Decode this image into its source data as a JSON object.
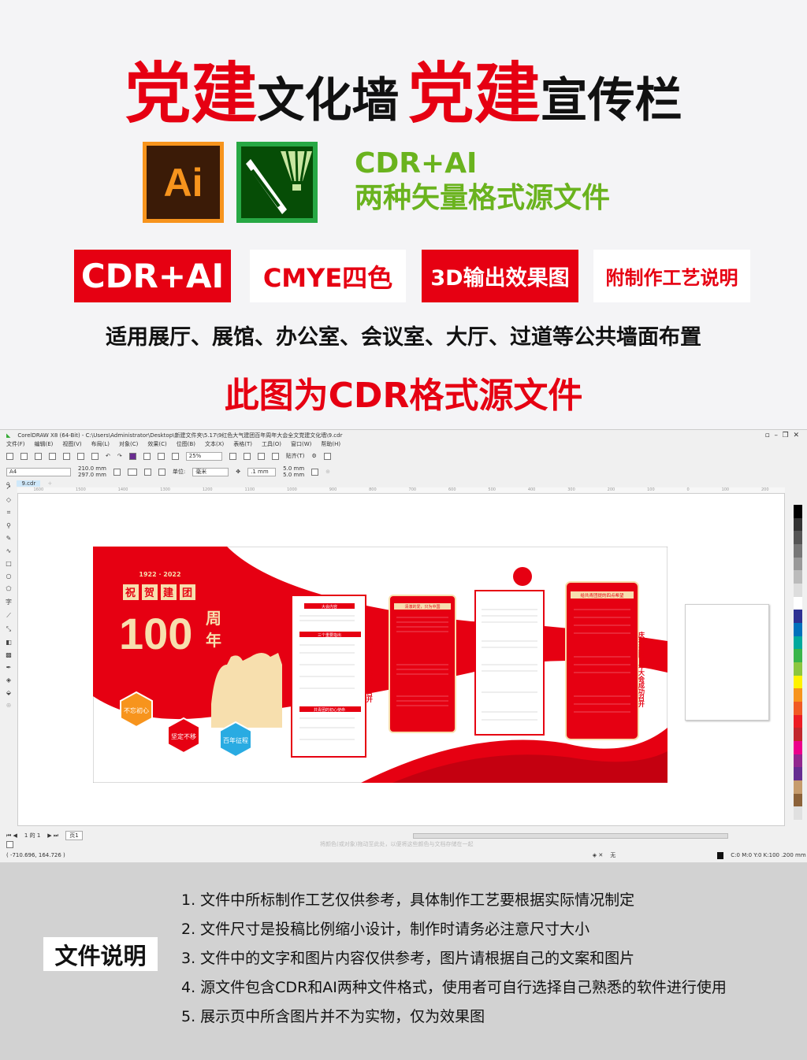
{
  "header": {
    "title_red_1": "党建",
    "title_black_1": "文化墙",
    "title_red_2": "党建",
    "title_black_2": "宣传栏"
  },
  "logos": {
    "ai_text": "Ai",
    "cdr_icon": "coreldraw-balloon-pen-icon"
  },
  "formats": {
    "line1": "CDR+AI",
    "line2": "两种矢量格式源文件"
  },
  "badges": [
    {
      "label": "CDR+AI",
      "style": "red"
    },
    {
      "label": "CMYE四色",
      "style": "white"
    },
    {
      "label": "3D输出效果图",
      "style": "red"
    },
    {
      "label": "附制作工艺说明",
      "style": "white"
    }
  ],
  "usage": "适用展厅、展馆、办公室、会议室、大厅、过道等公共墙面布置",
  "source_note": "此图为CDR格式源文件",
  "app": {
    "title": "CorelDRAW X8 (64-Bit) - C:\\Users\\Administrator\\Desktop\\新建文件夹\\5.17\\9红色大气建团百年周年大会全文党建文化墙\\9.cdr",
    "menu": [
      "文件(F)",
      "编辑(E)",
      "视图(V)",
      "布局(L)",
      "对象(C)",
      "效果(C)",
      "位图(B)",
      "文本(X)",
      "表格(T)",
      "工具(O)",
      "窗口(W)",
      "帮助(H)"
    ],
    "zoom": "25%",
    "snap": "贴齐(T)",
    "page_size": "A4",
    "width": "210.0 mm",
    "height": "297.0 mm",
    "unit_label": "单位:",
    "unit": "毫米",
    "nudge": ".1 mm",
    "dup_x": "5.0 mm",
    "dup_y": "5.0 mm",
    "tab": "9.cdr",
    "ruler": [
      "1600",
      "1500",
      "1400",
      "1300",
      "1200",
      "1100",
      "1000",
      "900",
      "800",
      "700",
      "600",
      "500",
      "400",
      "300",
      "200",
      "100",
      "0",
      "100",
      "200"
    ],
    "page_nav": "1 的 1",
    "page_tab": "页1",
    "hint": "将颜色(或对象)拖动至此处，以便将这些颜色与文档存储在一起",
    "coords": "( -710.696, 164.726 )",
    "fill_none": "无",
    "outline": "C:0 M:0 Y:0 K:100  .200 mm",
    "palette": [
      "#000000",
      "#333333",
      "#555555",
      "#777777",
      "#999999",
      "#bbbbbb",
      "#dddddd",
      "#ffffff",
      "#2e3192",
      "#0071bc",
      "#00a99d",
      "#39b54a",
      "#8cc63f",
      "#fff200",
      "#f7941d",
      "#f15a24",
      "#ed1c24",
      "#c1272d",
      "#ec008c",
      "#92278f",
      "#662d91",
      "#c69c6d",
      "#8c6239",
      "#e0e0e0"
    ]
  },
  "artwork": {
    "years": "1922 · 2022",
    "headline": [
      "祝",
      "贺",
      "建",
      "团"
    ],
    "hundred": "100",
    "suffix": [
      "周",
      "年"
    ],
    "hex": [
      "不忘初心",
      "坚定不移",
      "百年征程"
    ],
    "panel1": [
      "大会内容",
      "三个重要指出",
      "共青团的初心使命"
    ],
    "panel2": "清澈的爱，只为中国",
    "panel4": "给共青团提的四点希望",
    "vertical": "庆祝建团百年大会成功召开"
  },
  "notes_section": {
    "label": "文件说明",
    "items": [
      "1. 文件中所标制作工艺仅供参考，具体制作工艺要根据实际情况制定",
      "2. 文件尺寸是投稿比例缩小设计，制作时请务必注意尺寸大小",
      "3. 文件中的文字和图片内容仅供参考，图片请根据自己的文案和图片",
      "4. 源文件包含CDR和AI两种文件格式，使用者可自行选择自己熟悉的软件进行使用",
      "5. 展示页中所含图片并不为实物，仅为效果图"
    ]
  },
  "colors": {
    "red": "#e60012",
    "green": "#6ab31e",
    "cream": "#f7dfae",
    "orange": "#f7941d",
    "blue": "#29abe2"
  }
}
